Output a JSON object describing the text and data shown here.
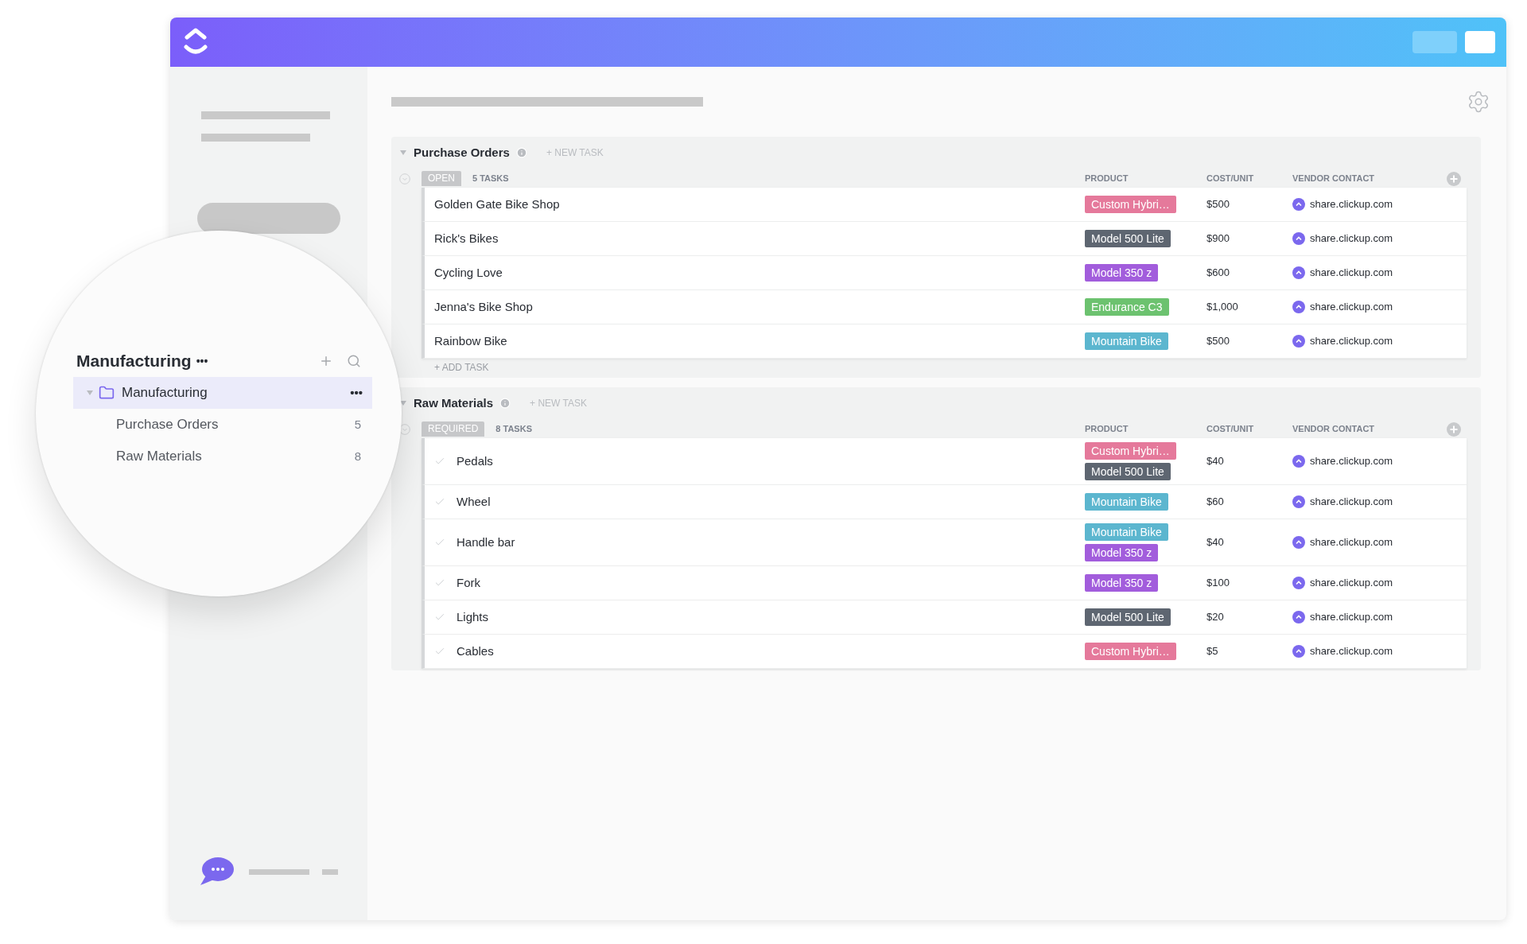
{
  "sidebar_zoom": {
    "title": "Manufacturing",
    "title_menu": "•••",
    "tree": [
      {
        "label": "Manufacturing",
        "menu": "•••",
        "expanded": true,
        "selected": true,
        "children": [
          {
            "label": "Purchase Orders",
            "count": "5",
            "selected": false
          },
          {
            "label": "Raw Materials",
            "count": "8",
            "selected": false
          }
        ]
      }
    ]
  },
  "lists": [
    {
      "title": "Purchase Orders",
      "kind": "tasks",
      "expanded": true,
      "new_task": "+ NEW TASK",
      "status": "OPEN",
      "task_count": "5 TASKS",
      "columns": [
        "PRODUCT",
        "COST/UNIT",
        "VENDOR CONTACT"
      ],
      "add_task": "+ ADD TASK",
      "rows": [
        {
          "name": "Golden Gate Bike Shop",
          "products": [
            {
              "label": "Custom Hybri…",
              "color": "#e5799b"
            }
          ],
          "cost": "$500",
          "vendor": "share.clickup.com"
        },
        {
          "name": "Rick's Bikes",
          "products": [
            {
              "label": "Model 500 Lite",
              "color": "#5e6671"
            }
          ],
          "cost": "$900",
          "vendor": "share.clickup.com"
        },
        {
          "name": "Cycling Love",
          "products": [
            {
              "label": "Model 350 z",
              "color": "#a25ddc"
            }
          ],
          "cost": "$600",
          "vendor": "share.clickup.com"
        },
        {
          "name": "Jenna's Bike Shop",
          "products": [
            {
              "label": "Endurance C3",
              "color": "#6cc26f"
            }
          ],
          "cost": "$1,000",
          "vendor": "share.clickup.com"
        },
        {
          "name": "Rainbow Bike",
          "products": [
            {
              "label": "Mountain Bike",
              "color": "#5cb6cf"
            }
          ],
          "cost": "$500",
          "vendor": "share.clickup.com"
        }
      ]
    },
    {
      "title": "Raw Materials",
      "kind": "checklist",
      "expanded": true,
      "new_task": "+ NEW TASK",
      "status": "REQUIRED",
      "task_count": "8 TASKS",
      "columns": [
        "PRODUCT",
        "COST/UNIT",
        "VENDOR CONTACT"
      ],
      "rows": [
        {
          "name": "Pedals",
          "products": [
            {
              "label": "Custom Hybri…",
              "color": "#e5799b"
            },
            {
              "label": "Model 500 Lite",
              "color": "#5e6671"
            }
          ],
          "cost": "$40",
          "vendor": "share.clickup.com"
        },
        {
          "name": "Wheel",
          "products": [
            {
              "label": "Mountain Bike",
              "color": "#5cb6cf"
            }
          ],
          "cost": "$60",
          "vendor": "share.clickup.com"
        },
        {
          "name": "Handle bar",
          "products": [
            {
              "label": "Mountain Bike",
              "color": "#5cb6cf"
            },
            {
              "label": "Model 350 z",
              "color": "#a25ddc"
            }
          ],
          "cost": "$40",
          "vendor": "share.clickup.com"
        },
        {
          "name": "Fork",
          "products": [
            {
              "label": "Model 350 z",
              "color": "#a25ddc"
            }
          ],
          "cost": "$100",
          "vendor": "share.clickup.com"
        },
        {
          "name": "Lights",
          "products": [
            {
              "label": "Model 500 Lite",
              "color": "#5e6671"
            }
          ],
          "cost": "$20",
          "vendor": "share.clickup.com"
        },
        {
          "name": "Cables",
          "products": [
            {
              "label": "Custom Hybri…",
              "color": "#e5799b"
            }
          ],
          "cost": "$5",
          "vendor": "share.clickup.com"
        }
      ]
    }
  ]
}
